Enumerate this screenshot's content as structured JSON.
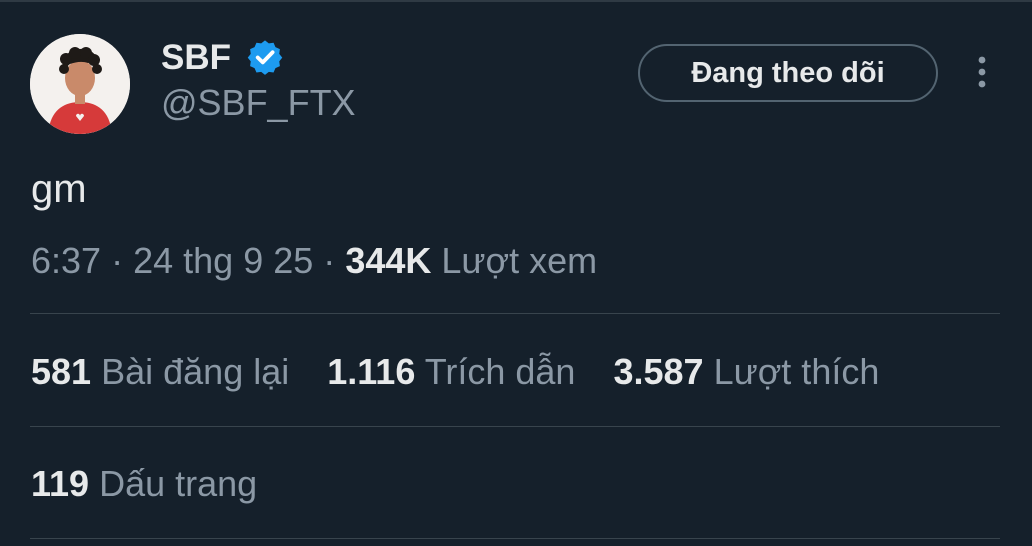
{
  "author": {
    "display_name": "SBF",
    "handle": "@SBF_FTX",
    "verified_icon": "verified-badge-icon",
    "avatar": "profile-avatar"
  },
  "actions": {
    "follow_label": "Đang theo dõi",
    "more_icon": "more-vertical-icon"
  },
  "tweet": {
    "text": "gm",
    "time": "6:37",
    "sep": "·",
    "date": "24 thg 9 25",
    "views_count": "344K",
    "views_label": "Lượt xem"
  },
  "stats": {
    "reposts_count": "581",
    "reposts_label": "Bài đăng lại",
    "quotes_count": "1.116",
    "quotes_label": "Trích dẫn",
    "likes_count": "3.587",
    "likes_label": "Lượt thích",
    "bookmarks_count": "119",
    "bookmarks_label": "Dấu trang"
  },
  "colors": {
    "background": "#15202b",
    "primary_text": "#e7e9ea",
    "secondary_text": "#8b98a5",
    "verified_blue": "#1d9bf0",
    "divider": "#38444d"
  }
}
